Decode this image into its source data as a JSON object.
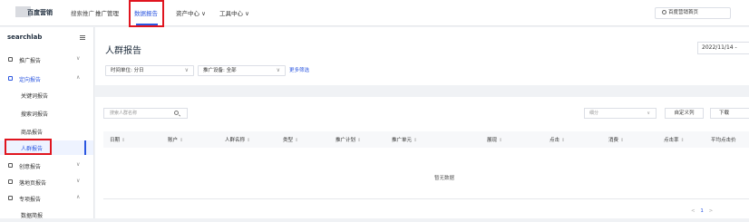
{
  "header": {
    "logo_text": "百度营销",
    "logo_sub": "搜索推广",
    "nav": [
      {
        "label": "推广管理"
      },
      {
        "label": "数据报告"
      },
      {
        "label": "资产中心 ∨"
      },
      {
        "label": "工具中心 ∨"
      }
    ],
    "home_button": "百度营销首页",
    "accent": "#2b56e0",
    "highlight": "#e0151f"
  },
  "sidebar": {
    "account": "searchlab",
    "items": [
      {
        "label": "推广报告",
        "icon": "chart-icon",
        "chevron": "∨"
      },
      {
        "label": "定向报告",
        "icon": "target-icon",
        "chevron": "∧"
      },
      {
        "label": "关键词报告"
      },
      {
        "label": "搜索词报告"
      },
      {
        "label": "商品报告"
      },
      {
        "label": "人群报告"
      },
      {
        "label": "创意报告",
        "icon": "creative-icon",
        "chevron": "∨"
      },
      {
        "label": "落地页报告",
        "icon": "page-icon",
        "chevron": "∨"
      },
      {
        "label": "专项报告",
        "icon": "special-icon",
        "chevron": "∧"
      },
      {
        "label": "数据简报"
      }
    ]
  },
  "main": {
    "title": "人群报告",
    "date_range": "2022/11/14 -",
    "filters": [
      {
        "label": "时间单位: 分日"
      },
      {
        "label": "推广设备: 全部"
      }
    ],
    "more_filter": "更多筛选"
  },
  "table": {
    "search_placeholder": "搜索人群名称",
    "select_placeholder": "细分",
    "custom_column": "自定义列",
    "download": "下载",
    "columns": [
      "日期",
      "账户",
      "人群名称",
      "类型",
      "推广计划",
      "推广单元",
      "展现",
      "点击",
      "消费",
      "点击率",
      "平均点击价"
    ],
    "empty_text": "暂无数据",
    "pager": {
      "prev": "<",
      "page": "1",
      "next": ">"
    }
  }
}
